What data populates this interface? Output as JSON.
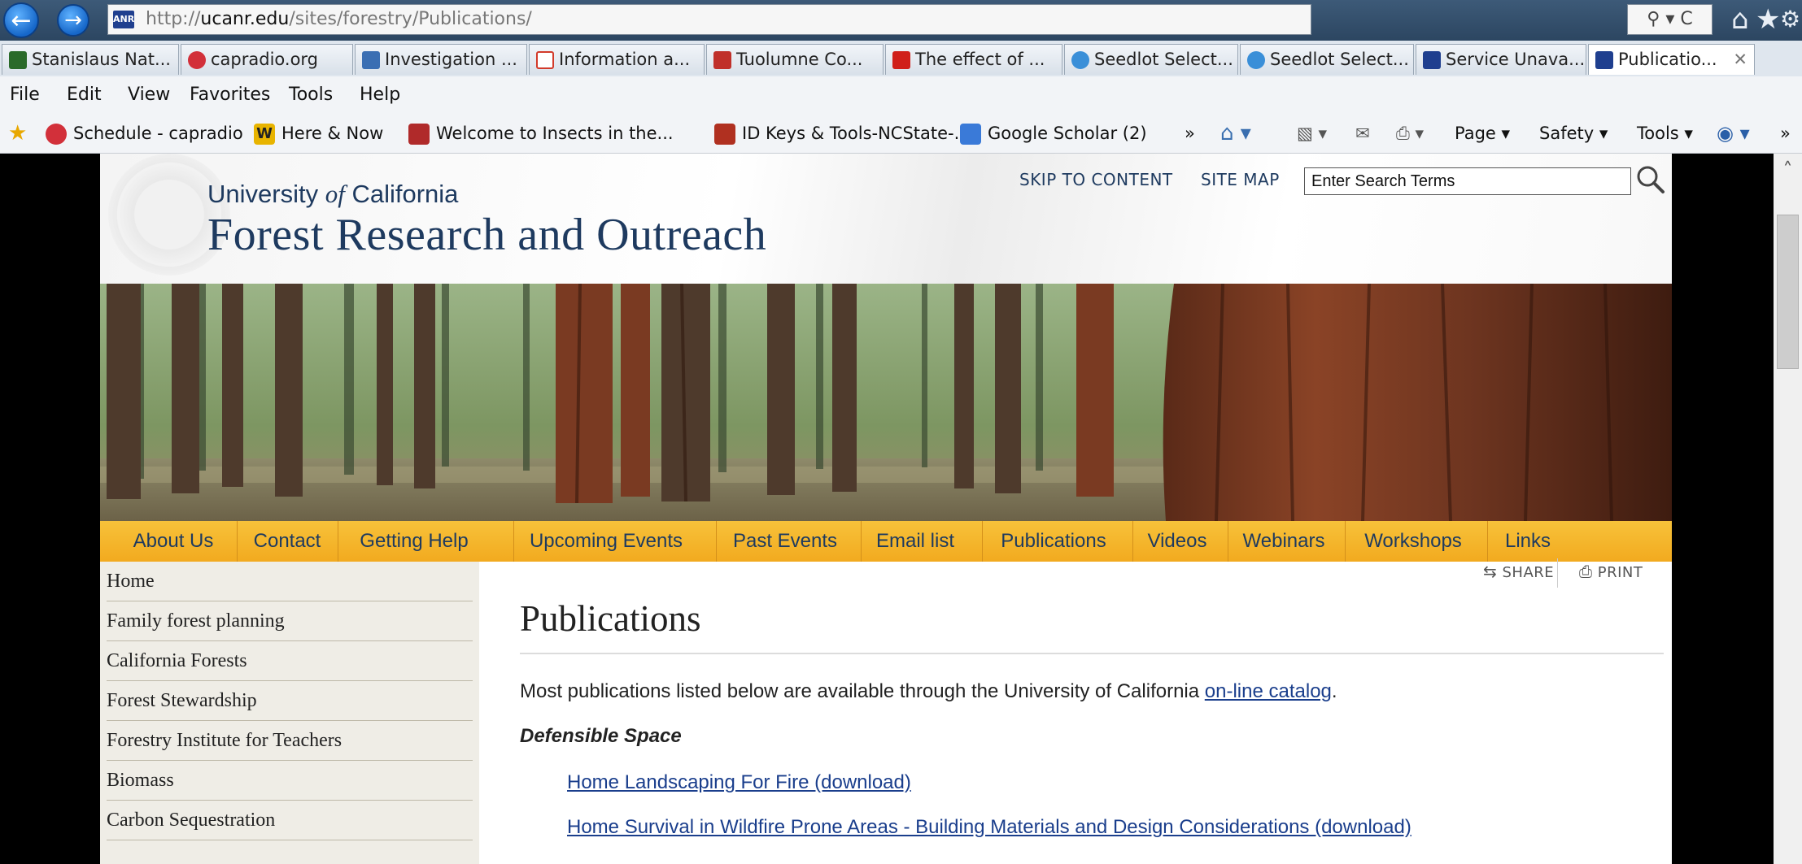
{
  "browser": {
    "url_prefix": "http://",
    "url_domain": "ucanr.edu",
    "url_path": "/sites/forestry/Publications/",
    "favicon_text": "ANR",
    "address_actions": "⚲ ▾ C"
  },
  "tabs": [
    {
      "label": "Stanislaus Nat...",
      "color": "#2a6a2a"
    },
    {
      "label": "capradio.org",
      "color": "#d2303a"
    },
    {
      "label": "Investigation ...",
      "color": "#3b6fb3"
    },
    {
      "label": "Information a...",
      "color": "#d23a2a"
    },
    {
      "label": "Tuolumne Co...",
      "color": "#c0302a"
    },
    {
      "label": "The effect of ...",
      "color": "#d0201a"
    },
    {
      "label": "Seedlot Select...",
      "color": "#3a8fd8"
    },
    {
      "label": "Seedlot Select...",
      "color": "#3a8fd8"
    },
    {
      "label": "Service Unava...",
      "color": "#1f3f8f"
    },
    {
      "label": "Publicatio...",
      "color": "#1f3f8f",
      "close": "✕"
    }
  ],
  "menu": [
    "File",
    "Edit",
    "View",
    "Favorites",
    "Tools",
    "Help"
  ],
  "favorites": [
    {
      "label": "Schedule - capradio",
      "color": "#d2303a"
    },
    {
      "label": "Here & Now",
      "color": "#e8b400",
      "glyph": "W"
    },
    {
      "label": "Welcome to Insects in the...",
      "color": "#b02a2a"
    },
    {
      "label": "ID Keys & Tools-NCState-...",
      "color": "#b03020"
    },
    {
      "label": "Google Scholar (2)",
      "color": "#3a7ad8"
    }
  ],
  "toolbar": {
    "overflow": "»",
    "page": "Page ▾",
    "safety": "Safety ▾",
    "tools": "Tools ▾",
    "overflow_right": "»"
  },
  "site": {
    "university": "University",
    "of": "of",
    "california": "California",
    "title": "Forest Research and Outreach",
    "skip": "SKIP TO CONTENT",
    "sitemap": "SITE MAP",
    "search_value": "Enter Search Terms"
  },
  "nav": [
    "About Us",
    "Contact",
    "Getting Help",
    "Upcoming Events",
    "Past Events",
    "Email list",
    "Publications",
    "Videos",
    "Webinars",
    "Workshops",
    "Links"
  ],
  "sidebar": [
    "Home",
    "Family forest planning",
    "California Forests",
    "Forest Stewardship",
    "Forestry Institute for Teachers",
    "Biomass",
    "Carbon Sequestration"
  ],
  "content": {
    "share": "SHARE",
    "print": "PRINT",
    "title": "Publications",
    "intro_text": "Most publications listed below are available through the University of California ",
    "intro_link": "on-line catalog",
    "intro_end": ".",
    "section": "Defensible Space",
    "publications": [
      "Home Landscaping For Fire (download)",
      "Home Survival in Wildfire Prone Areas - Building Materials and Design Considerations (download)"
    ]
  },
  "colors": {
    "nav_bg": "#f2aa1f",
    "brand_blue": "#1e3a5f",
    "link": "#1a3e8c"
  }
}
